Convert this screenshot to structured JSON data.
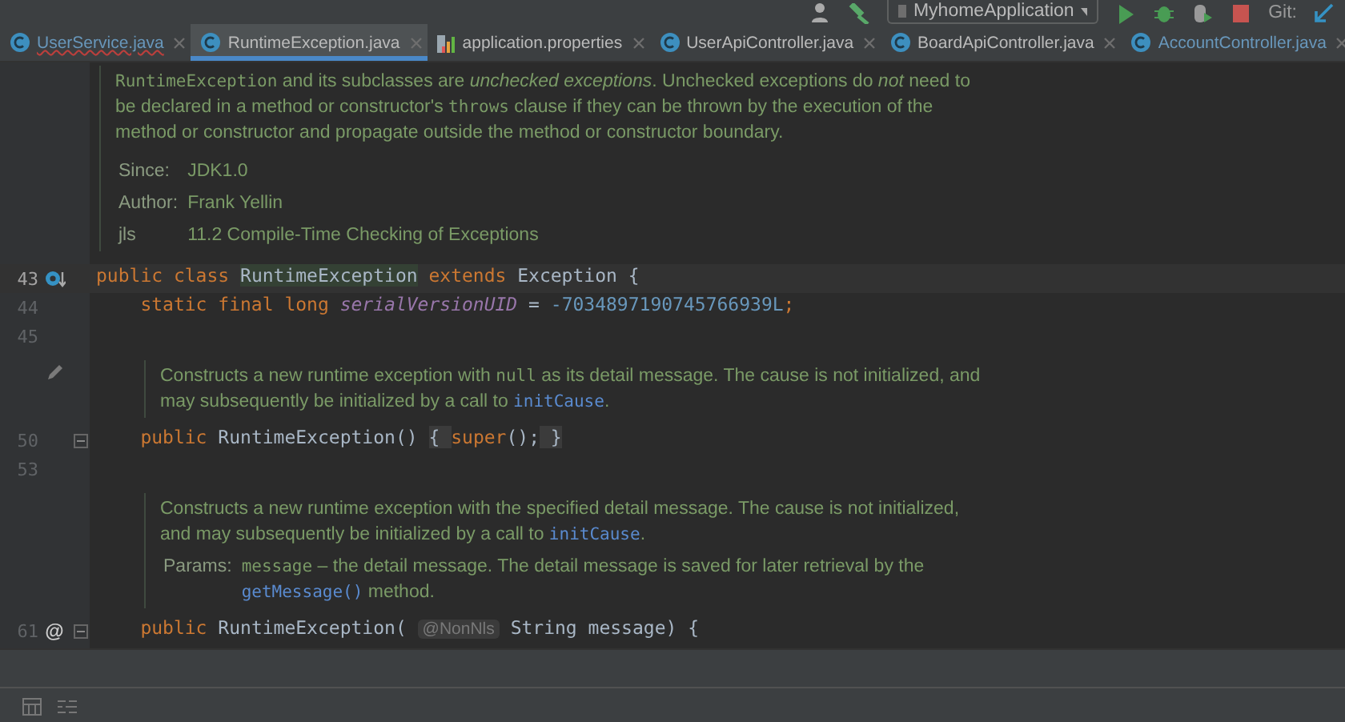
{
  "toolbar": {
    "run_config": "MyhomeApplication",
    "git_label": "Git:"
  },
  "tabs": [
    {
      "label": "UserService.java",
      "kind": "class",
      "selected": false,
      "modified": true,
      "error": true
    },
    {
      "label": "RuntimeException.java",
      "kind": "class",
      "selected": true,
      "modified": false,
      "error": false
    },
    {
      "label": "application.properties",
      "kind": "properties",
      "selected": false,
      "modified": false,
      "error": false
    },
    {
      "label": "UserApiController.java",
      "kind": "class",
      "selected": false,
      "modified": false,
      "error": false
    },
    {
      "label": "BoardApiController.java",
      "kind": "class",
      "selected": false,
      "modified": false,
      "error": false
    },
    {
      "label": "AccountController.java",
      "kind": "class",
      "selected": false,
      "modified": true,
      "error": false
    }
  ],
  "editor": {
    "blocks": [
      {
        "kind": "doc",
        "indented": false,
        "paragraphs": [
          [
            {
              "text": "RuntimeException",
              "kind": "code"
            },
            {
              "text": " and its subclasses are ",
              "kind": "plain"
            },
            {
              "text": "unchecked exceptions",
              "kind": "italic"
            },
            {
              "text": ". Unchecked exceptions do ",
              "kind": "plain"
            },
            {
              "text": "not",
              "kind": "italic"
            },
            {
              "text": " need to be declared in a method or constructor's ",
              "kind": "plain"
            },
            {
              "text": "throws",
              "kind": "code"
            },
            {
              "text": " clause if they can be thrown by the execution of the method or constructor and propagate outside the method or constructor boundary.",
              "kind": "plain"
            }
          ]
        ],
        "tags": [
          {
            "label": "Since:",
            "value": [
              {
                "text": "JDK1.0",
                "kind": "plain"
              }
            ]
          },
          {
            "label": "Author:",
            "value": [
              {
                "text": "Frank Yellin",
                "kind": "plain"
              }
            ]
          },
          {
            "label": "jls",
            "value": [
              {
                "text": "11.2 Compile-Time Checking of Exceptions",
                "kind": "plain"
              }
            ]
          }
        ]
      },
      {
        "kind": "code",
        "number": "43",
        "gutter": {
          "kind": "implemented"
        },
        "fold": false,
        "current": true,
        "tokens": [
          {
            "text": "public class ",
            "kind": "keyword"
          },
          {
            "text": "RuntimeException",
            "kind": "highlight"
          },
          {
            "text": " extends ",
            "kind": "keyword"
          },
          {
            "text": "Exception {",
            "kind": "plain"
          }
        ]
      },
      {
        "kind": "code",
        "number": "44",
        "fold": false,
        "current": false,
        "tokens": [
          {
            "text": "    static final long ",
            "kind": "keyword"
          },
          {
            "text": "serialVersionUID",
            "kind": "field"
          },
          {
            "text": " = ",
            "kind": "plain"
          },
          {
            "text": "-7034897190745766939L",
            "kind": "number"
          },
          {
            "text": ";",
            "kind": "keyword"
          }
        ]
      },
      {
        "kind": "code",
        "number": "45",
        "fold": false,
        "current": false
      },
      {
        "kind": "doc",
        "indented": true,
        "gutter": {
          "kind": "edit"
        },
        "paragraphs": [
          [
            {
              "text": "Constructs a new runtime exception with ",
              "kind": "plain"
            },
            {
              "text": "null",
              "kind": "code"
            },
            {
              "text": " as its detail message. The cause is not initialized, and may subsequently be initialized by a call to ",
              "kind": "plain"
            },
            {
              "text": "initCause",
              "kind": "link"
            },
            {
              "text": ".",
              "kind": "plain"
            }
          ]
        ]
      },
      {
        "kind": "code",
        "number": "50",
        "fold": true,
        "current": false,
        "tokens": [
          {
            "text": "    public ",
            "kind": "keyword"
          },
          {
            "text": "RuntimeException() ",
            "kind": "plain"
          },
          {
            "text": "{ ",
            "kind": "folded"
          },
          {
            "text": "super",
            "kind": "keyword"
          },
          {
            "text": "();",
            "kind": "plain"
          },
          {
            "text": " }",
            "kind": "folded"
          }
        ]
      },
      {
        "kind": "code",
        "number": "53",
        "fold": false,
        "current": false
      },
      {
        "kind": "doc",
        "indented": true,
        "paragraphs": [
          [
            {
              "text": "Constructs a new runtime exception with the specified detail message. The cause is not initialized, and may subsequently be initialized by a call to ",
              "kind": "plain"
            },
            {
              "text": "initCause",
              "kind": "link"
            },
            {
              "text": ".",
              "kind": "plain"
            }
          ]
        ],
        "tags": [
          {
            "label": "Params:",
            "value": [
              {
                "text": "message",
                "kind": "code"
              },
              {
                "text": " – the detail message. The detail message is saved for later retrieval by the ",
                "kind": "plain"
              },
              {
                "text": "getMessage()",
                "kind": "link"
              },
              {
                "text": " method.",
                "kind": "plain"
              }
            ]
          }
        ]
      },
      {
        "kind": "code",
        "number": "61",
        "gutter": {
          "kind": "annotation",
          "text": "@"
        },
        "fold": true,
        "current": false,
        "tokens": [
          {
            "text": "    public ",
            "kind": "keyword"
          },
          {
            "text": "RuntimeException( ",
            "kind": "plain"
          },
          {
            "text": "@NonNls",
            "kind": "hint"
          },
          {
            "text": " String message) {",
            "kind": "plain"
          }
        ]
      }
    ]
  }
}
